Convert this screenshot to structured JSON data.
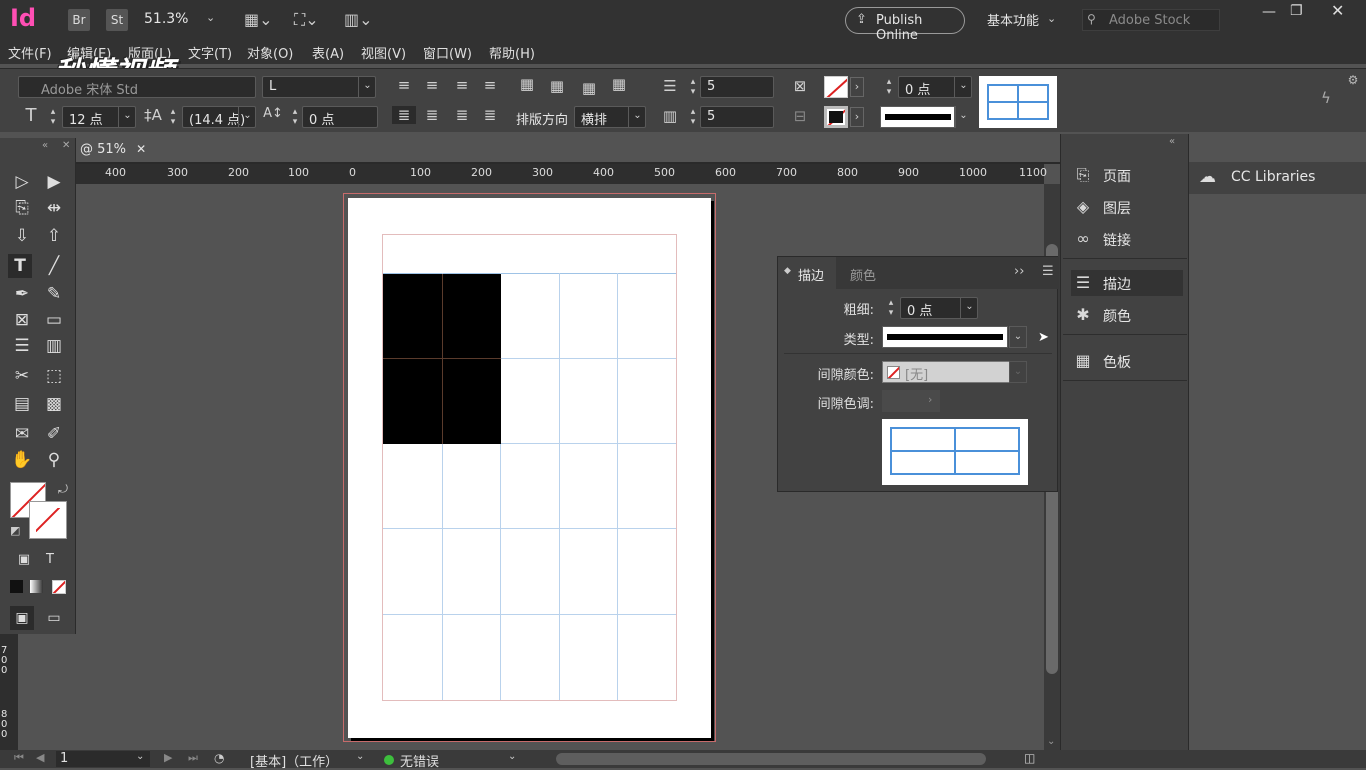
{
  "app": {
    "logo": "Id",
    "bridge_btn": "Br",
    "stock_btn": "St",
    "zoom": "51.3%",
    "publish_label": "Publish Online",
    "workspace": "基本功能",
    "search_placeholder": "Adobe Stock"
  },
  "menu": [
    "文件(F)",
    "编辑(E)",
    "版面(L)",
    "文字(T)",
    "对象(O)",
    "表(A)",
    "视图(V)",
    "窗口(W)",
    "帮助(H)"
  ],
  "watermark": "秒懂视频",
  "control": {
    "font_family": "Adobe 宋体 Std",
    "font_style": "L",
    "font_size": "12 点",
    "leading": "(14.4 点)",
    "tracking": "0 点",
    "rows_value": "5",
    "cols_value": "5",
    "direction_label": "排版方向",
    "direction_value": "横排",
    "stroke_weight": "0 点"
  },
  "document": {
    "tab_label": "@ 51%",
    "ruler_labels": [
      "400",
      "300",
      "200",
      "100",
      "0",
      "100",
      "200",
      "300",
      "400",
      "500",
      "600",
      "700",
      "800",
      "900",
      "1000",
      "1100"
    ],
    "vruler_labels": [
      "700",
      "800"
    ]
  },
  "stroke_panel": {
    "tab_active": "描边",
    "tab_inactive": "颜色",
    "weight_label": "粗细:",
    "weight_value": "0 点",
    "type_label": "类型:",
    "gap_color_label": "间隙颜色:",
    "gap_color_value": "[无]",
    "gap_tint_label": "间隙色调:"
  },
  "dock": {
    "items": [
      "页面",
      "图层",
      "链接",
      "描边",
      "颜色",
      "色板"
    ],
    "libraries": "CC Libraries"
  },
  "status": {
    "page_number": "1",
    "preflight_profile": "[基本]（工作）",
    "errors": "无错误"
  },
  "colors": {
    "accent_blue": "#4a90d9",
    "status_ok": "#3dbf3d",
    "none_red": "#d22"
  }
}
